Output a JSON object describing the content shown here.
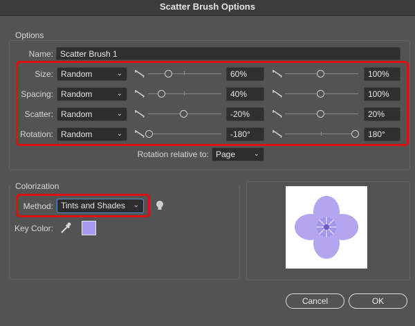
{
  "dialog": {
    "title": "Scatter Brush Options"
  },
  "options": {
    "section_label": "Options",
    "name_label": "Name:",
    "name_value": "Scatter Brush 1",
    "rows": [
      {
        "label": "Size:",
        "mode": "Random",
        "min": "60%",
        "max": "100%"
      },
      {
        "label": "Spacing:",
        "mode": "Random",
        "min": "40%",
        "max": "100%"
      },
      {
        "label": "Scatter:",
        "mode": "Random",
        "min": "-20%",
        "max": "20%"
      },
      {
        "label": "Rotation:",
        "mode": "Random",
        "min": "-180°",
        "max": "180°"
      }
    ],
    "rotation_relative_label": "Rotation relative to:",
    "rotation_relative_value": "Page"
  },
  "colorization": {
    "section_label": "Colorization",
    "method_label": "Method:",
    "method_value": "Tints and Shades",
    "key_color_label": "Key Color:",
    "key_color": "#ab9af2"
  },
  "buttons": {
    "cancel": "Cancel",
    "ok": "OK"
  },
  "colors": {
    "highlight": "#e01010",
    "flower": "#b3a6ee",
    "flower_center": "#6b5bc9"
  },
  "icons": [
    "variation-icon",
    "tips-lightbulb-icon",
    "eyedropper-icon"
  ]
}
